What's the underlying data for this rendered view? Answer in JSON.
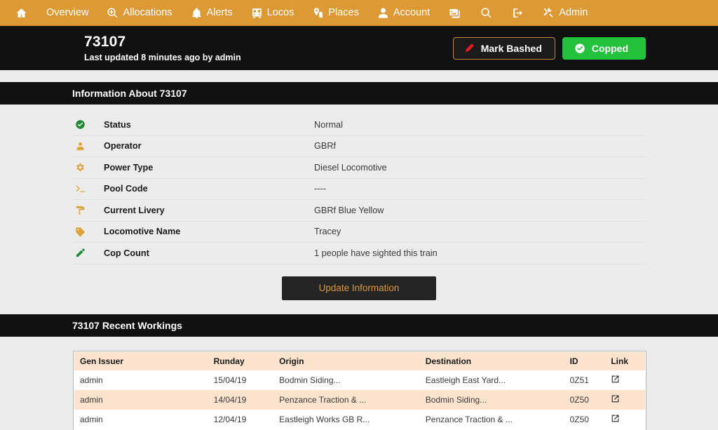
{
  "nav": {
    "items": [
      {
        "label": "",
        "icon": "home-icon",
        "name": "nav-home"
      },
      {
        "label": "Overview",
        "icon": "",
        "name": "nav-overview"
      },
      {
        "label": "Allocations",
        "icon": "search-plus-icon",
        "name": "nav-allocations"
      },
      {
        "label": "Alerts",
        "icon": "bell-icon",
        "name": "nav-alerts"
      },
      {
        "label": "Locos",
        "icon": "train-icon",
        "name": "nav-locos"
      },
      {
        "label": "Places",
        "icon": "map-marker-icon",
        "name": "nav-places"
      },
      {
        "label": "Account",
        "icon": "user-icon",
        "name": "nav-account"
      },
      {
        "label": "",
        "icon": "images-icon",
        "name": "nav-gallery"
      },
      {
        "label": "",
        "icon": "search-icon",
        "name": "nav-search"
      },
      {
        "label": "",
        "icon": "sign-out-icon",
        "name": "nav-logout"
      },
      {
        "label": "Admin",
        "icon": "tools-icon",
        "name": "nav-admin"
      }
    ]
  },
  "header": {
    "title": "73107",
    "subtitle": "Last updated 8 minutes ago by admin",
    "mark_bashed_label": "Mark Bashed",
    "copped_label": "Copped"
  },
  "info_section": {
    "heading": "Information About 73107",
    "rows": [
      {
        "icon": "check-circle-icon",
        "icon_color": "#1d8a34",
        "label": "Status",
        "value": "Normal"
      },
      {
        "icon": "user-icon",
        "icon_color": "#e0a33c",
        "label": "Operator",
        "value": "GBRf"
      },
      {
        "icon": "cog-icon",
        "icon_color": "#e0a33c",
        "label": "Power Type",
        "value": "Diesel Locomotive"
      },
      {
        "icon": "terminal-icon",
        "icon_color": "#e0a33c",
        "label": "Pool Code",
        "value": "----"
      },
      {
        "icon": "paint-roller-icon",
        "icon_color": "#e0a33c",
        "label": "Current Livery",
        "value": "GBRf Blue Yellow"
      },
      {
        "icon": "tag-icon",
        "icon_color": "#e0a33c",
        "label": "Locomotive Name",
        "value": "Tracey"
      },
      {
        "icon": "pen-icon",
        "icon_color": "#1d8a34",
        "label": "Cop Count",
        "value": "1 people have sighted this train"
      }
    ],
    "update_button_label": "Update Information"
  },
  "workings_section": {
    "heading": "73107 Recent Workings",
    "columns": [
      "Gen Issuer",
      "Runday",
      "Origin",
      "Destination",
      "ID",
      "Link"
    ],
    "rows": [
      {
        "issuer": "admin",
        "runday": "15/04/19",
        "origin": "Bodmin Siding...",
        "destination": "Eastleigh East Yard...",
        "id": "0Z51",
        "link": "external-link-icon"
      },
      {
        "issuer": "admin",
        "runday": "14/04/19",
        "origin": "Penzance Traction & ...",
        "destination": "Bodmin Siding...",
        "id": "0Z50",
        "link": "external-link-icon"
      },
      {
        "issuer": "admin",
        "runday": "12/04/19",
        "origin": "Eastleigh Works GB R...",
        "destination": "Penzance Traction & ...",
        "id": "0Z50",
        "link": "external-link-icon"
      }
    ]
  },
  "colors": {
    "nav_bg": "#dd9933",
    "header_bg": "#111111",
    "page_bg": "#ececec",
    "accent_orange": "#d79a3e",
    "success_green": "#22c23c",
    "table_alt_row": "#fbe3ce"
  }
}
